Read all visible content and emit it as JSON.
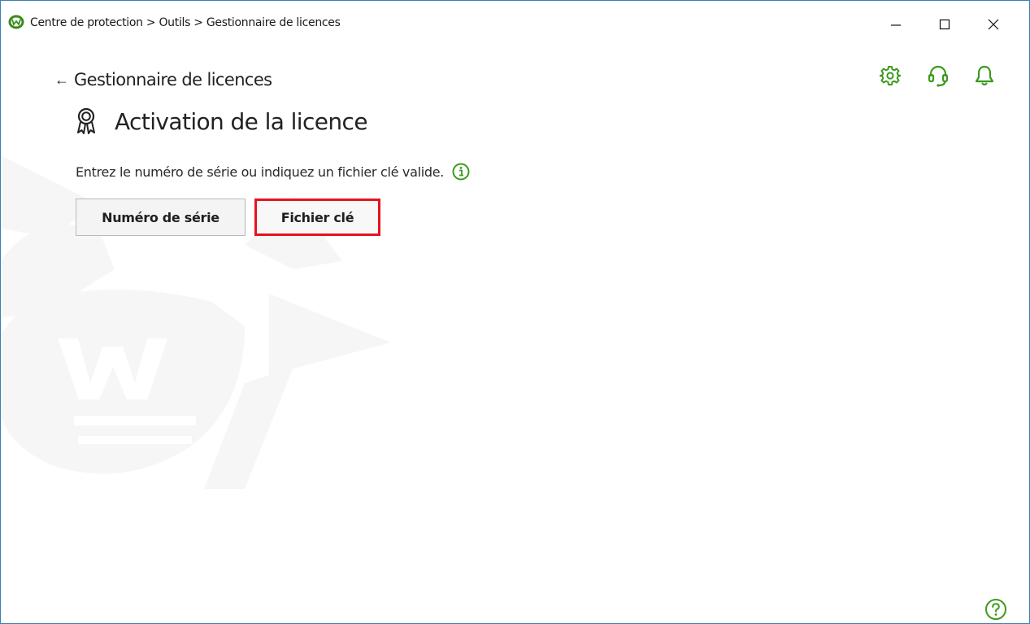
{
  "window": {
    "title": "Centre de protection > Outils > Gestionnaire de licences",
    "controls": {
      "minimize": "minimize",
      "maximize": "maximize",
      "close": "close"
    }
  },
  "header": {
    "icons": [
      "settings-icon",
      "support-icon",
      "notifications-icon"
    ],
    "accent_color": "#3c9a1c"
  },
  "nav": {
    "back_arrow": "←",
    "back_label": "Gestionnaire de licences"
  },
  "main": {
    "title": "Activation de la licence",
    "description": "Entrez le numéro de série ou indiquez un fichier clé valide.",
    "buttons": {
      "serial_label": "Numéro de série",
      "keyfile_label": "Fichier clé"
    },
    "highlight_color": "#e5131f"
  },
  "footer": {
    "help_icon": "help-icon"
  }
}
